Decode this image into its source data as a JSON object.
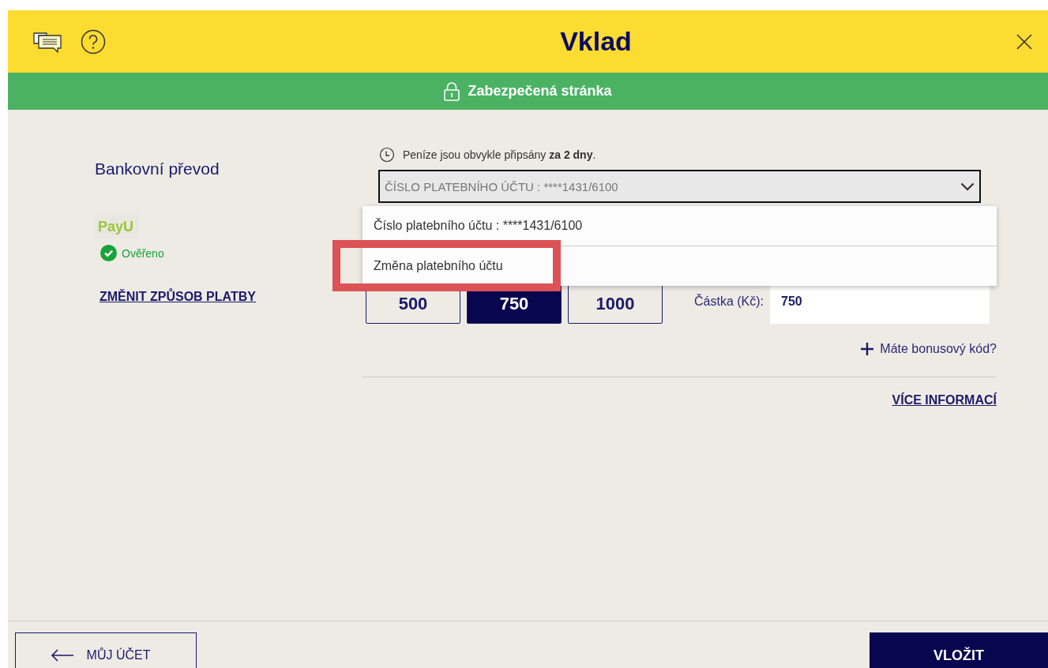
{
  "header": {
    "title": "Vklad"
  },
  "secure_bar": {
    "label": "Zabezpečená stránka"
  },
  "payment_method": {
    "title": "Bankovní převod",
    "provider_logo": "PayU",
    "status": "Ověřeno",
    "verified": true,
    "change_link": "ZMĚNIT ZPŮSOB PLATBY"
  },
  "info": "Peníze jsou obvykle připsány **za 2 dny**.",
  "account_select": {
    "value": "ČÍSLO PLATEBNÍHO ÚČTU : ****1431/6100",
    "expanded": true,
    "options": [
      {
        "label": "Číslo platebního účtu : ****1431/6100",
        "highlighted": false
      },
      {
        "label": "Změna platebního účtu",
        "highlighted": true
      }
    ]
  },
  "amounts": [
    {
      "label": "500",
      "selected": false
    },
    {
      "label": "750",
      "selected": true
    },
    {
      "label": "1000",
      "selected": false
    }
  ],
  "amount_field": {
    "label": "Částka (Kč):",
    "value": "750"
  },
  "bonus_link": "Máte bonusový kód?",
  "more_info_link": "VÍCE INFORMACÍ",
  "footer": {
    "back_button": "MŮJ ÚČET",
    "submit_button": "VLOŽIT"
  }
}
